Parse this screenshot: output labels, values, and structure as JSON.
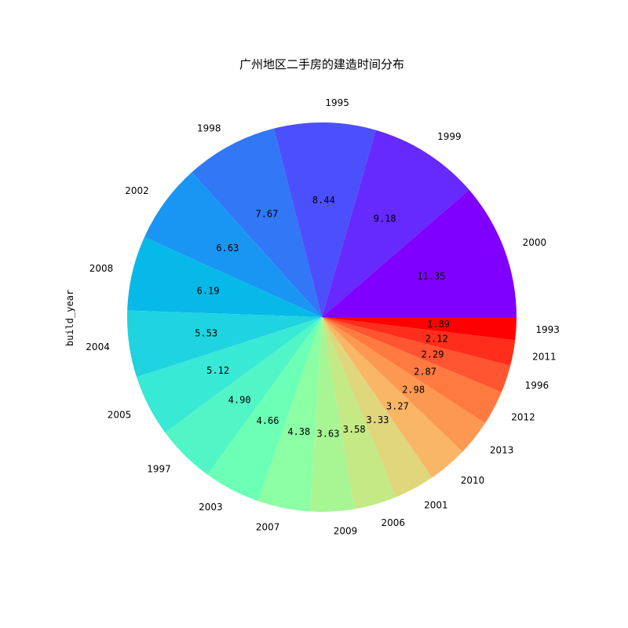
{
  "chart_data": {
    "type": "pie",
    "title": "广州地区二手房的建造时间分布",
    "ylabel": "build_year",
    "start_angle": 0,
    "direction": "counterclockwise",
    "slices": [
      {
        "label": "2000",
        "value": 11.35,
        "value_text": "11.35",
        "color": "#8000ff"
      },
      {
        "label": "1999",
        "value": 9.18,
        "value_text": "9.18",
        "color": "#6629fe"
      },
      {
        "label": "1995",
        "value": 8.44,
        "value_text": "8.44",
        "color": "#4c50fc"
      },
      {
        "label": "1998",
        "value": 7.67,
        "value_text": "7.67",
        "color": "#3177f6"
      },
      {
        "label": "2002",
        "value": 6.63,
        "value_text": "6.63",
        "color": "#1996f3"
      },
      {
        "label": "2008",
        "value": 6.19,
        "value_text": "6.19",
        "color": "#07b9e8"
      },
      {
        "label": "2004",
        "value": 5.53,
        "value_text": "5.53",
        "color": "#1fd3e0"
      },
      {
        "label": "2005",
        "value": 5.12,
        "value_text": "5.12",
        "color": "#38e9d6"
      },
      {
        "label": "1997",
        "value": 4.9,
        "value_text": "4.90",
        "color": "#52f5c6"
      },
      {
        "label": "2003",
        "value": 4.66,
        "value_text": "4.66",
        "color": "#6cffb6"
      },
      {
        "label": "2007",
        "value": 4.38,
        "value_text": "4.38",
        "color": "#8cfea4"
      },
      {
        "label": "2009",
        "value": 3.63,
        "value_text": "3.63",
        "color": "#a8f594"
      },
      {
        "label": "2006",
        "value": 3.58,
        "value_text": "3.58",
        "color": "#c4e985"
      },
      {
        "label": "2001",
        "value": 3.33,
        "value_text": "3.33",
        "color": "#e0d67c"
      },
      {
        "label": "2010",
        "value": 3.27,
        "value_text": "3.27",
        "color": "#f9b666"
      },
      {
        "label": "2013",
        "value": 2.98,
        "value_text": "2.98",
        "color": "#fd9852"
      },
      {
        "label": "2012",
        "value": 2.87,
        "value_text": "2.87",
        "color": "#ff7a40"
      },
      {
        "label": "1996",
        "value": 2.29,
        "value_text": "2.29",
        "color": "#ff5530"
      },
      {
        "label": "2011",
        "value": 2.12,
        "value_text": "2.12",
        "color": "#ff2e1c"
      },
      {
        "label": "1993",
        "value": 1.89,
        "value_text": "1.89",
        "color": "#ff0000"
      }
    ]
  }
}
